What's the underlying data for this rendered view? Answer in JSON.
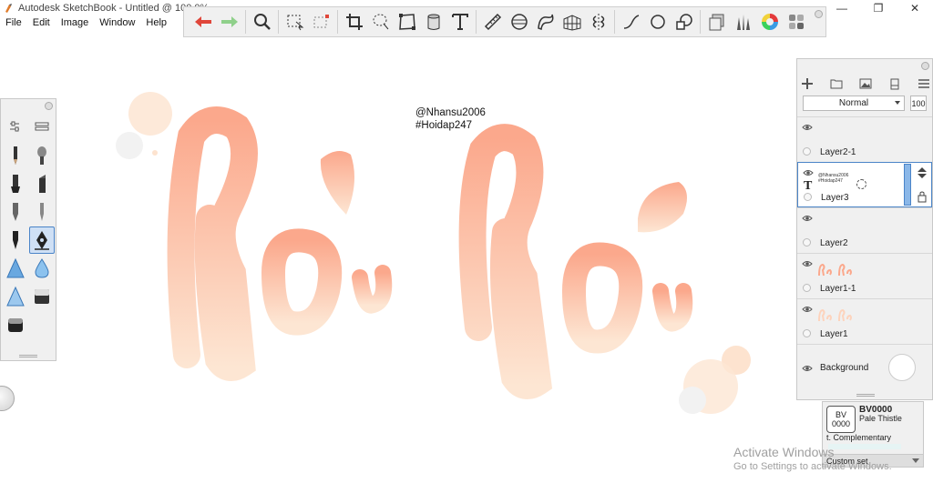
{
  "window": {
    "title": "Autodesk SketchBook - Untitled @ 100.0%",
    "minimize": "—",
    "maximize": "❐",
    "close": "✕"
  },
  "menu": [
    "File",
    "Edit",
    "Image",
    "Window",
    "Help"
  ],
  "toolbar": {
    "icons": [
      "undo-icon",
      "redo-icon",
      "zoom-icon",
      "select-icon",
      "transform-select-icon",
      "crop-icon",
      "lasso-icon",
      "distort-icon",
      "bucket-icon",
      "text-icon",
      "ruler-icon",
      "ellipse-guide-icon",
      "french-curve-icon",
      "perspective-icon",
      "symmetry-icon",
      "stroke-icon",
      "circle-icon",
      "shape-icon",
      "layer-editor-icon",
      "brush-library-icon",
      "color-wheel-icon",
      "copic-icon"
    ]
  },
  "canvas": {
    "line1": "@Nhansu2006",
    "line2": "#Hoidap247"
  },
  "layers": {
    "blend_mode": "Normal",
    "opacity": "100",
    "text_layer_preview_1": "@Nhansu2006",
    "text_layer_preview_2": "#Hoidap247",
    "items": [
      {
        "name": "Layer2-1"
      },
      {
        "name": "Layer3"
      },
      {
        "name": "Layer2"
      },
      {
        "name": "Layer1-1"
      },
      {
        "name": "Layer1"
      },
      {
        "name": "Background"
      }
    ]
  },
  "copic": {
    "swatch_top": "BV",
    "swatch_bottom": "0000",
    "code": "BV0000",
    "name": "Pale Thistle",
    "complementary": "t. Complementary",
    "set": "Custom set"
  },
  "watermark": {
    "title": "Activate Windows",
    "subtitle": "Go to Settings to activate Windows."
  },
  "colors": {
    "accent": "#4a84c8",
    "stroke_peach": "#fba88c",
    "stroke_light": "#fde4d0"
  }
}
